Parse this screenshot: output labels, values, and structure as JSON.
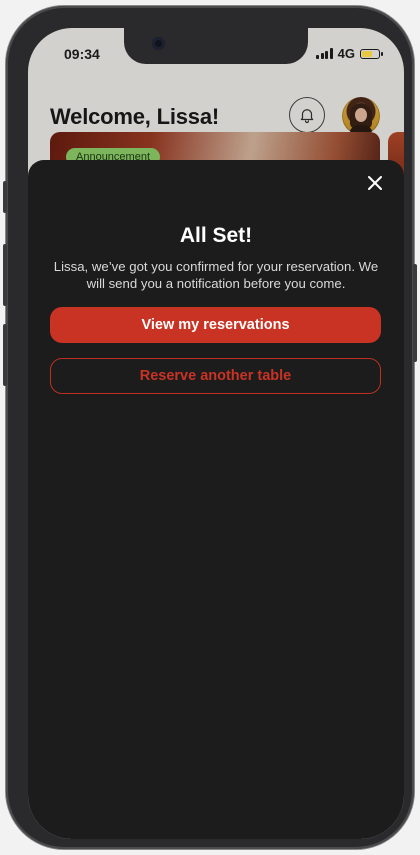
{
  "status_bar": {
    "time": "09:34",
    "network": "4G",
    "battery_level": 0.6,
    "battery_color": "#e8c840"
  },
  "header": {
    "greeting": "Welcome,  Lissa!",
    "bell_icon": "bell-icon",
    "avatar_icon": "user-avatar"
  },
  "promo": {
    "badge_label": "Announcement"
  },
  "modal": {
    "close_icon": "close-icon",
    "title": "All Set!",
    "message": "Lissa, we’ve got you confirmed for your reservation. We will send you a notification before you come.",
    "primary_button_label": "View my reservations",
    "secondary_button_label": "Reserve another table",
    "accent_color": "#c93324",
    "sheet_color": "#1c1c1d"
  }
}
